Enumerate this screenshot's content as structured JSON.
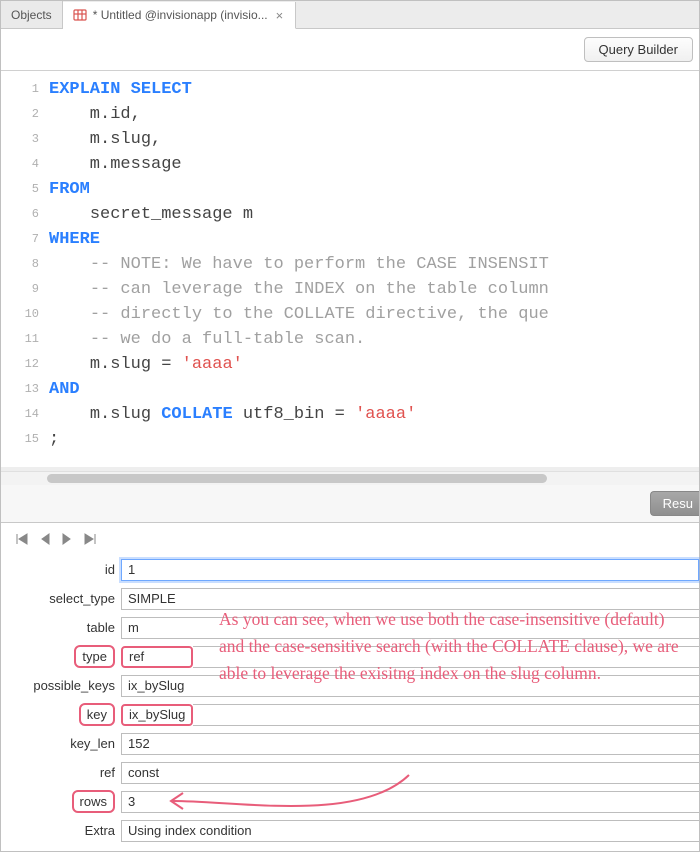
{
  "tabs": {
    "objects": "Objects",
    "active": "* Untitled @invisionapp (invisio..."
  },
  "toolbar": {
    "query_builder": "Query Builder"
  },
  "editor": {
    "kw_explain": "EXPLAIN",
    "kw_select": "SELECT",
    "col_id": "id",
    "col_slug": "slug",
    "col_message": "message",
    "kw_from": "FROM",
    "tbl": "secret_message m",
    "kw_where": "WHERE",
    "cmt1": "-- NOTE: We have to perform the CASE INSENSIT",
    "cmt2": "-- can leverage the INDEX on the table column",
    "cmt3": "-- directly to the COLLATE directive, the que",
    "cmt4": "-- we do a full-table scan.",
    "pred1_lhs": "m.slug = ",
    "str_aaaa": "'aaaa'",
    "kw_and": "AND",
    "pred2_lhs": "m.slug ",
    "kw_collate": "COLLATE",
    "pred2_rhs": " utf8_bin = ",
    "semi": ";"
  },
  "results": {
    "btn": "Resu",
    "fields": {
      "id": {
        "label": "id",
        "value": "1"
      },
      "select_type": {
        "label": "select_type",
        "value": "SIMPLE"
      },
      "table": {
        "label": "table",
        "value": "m"
      },
      "type": {
        "label": "type",
        "value": "ref"
      },
      "possible_keys": {
        "label": "possible_keys",
        "value": "ix_bySlug"
      },
      "key": {
        "label": "key",
        "value": "ix_bySlug"
      },
      "key_len": {
        "label": "key_len",
        "value": "152"
      },
      "ref": {
        "label": "ref",
        "value": "const"
      },
      "rows": {
        "label": "rows",
        "value": "3"
      },
      "extra": {
        "label": "Extra",
        "value": "Using index condition"
      }
    }
  },
  "annotation": "As you can see, when we use both the case-insensitive (default) and the case-sensitive search (with the COLLATE clause), we are able to leverage the exisitng index on the slug column."
}
